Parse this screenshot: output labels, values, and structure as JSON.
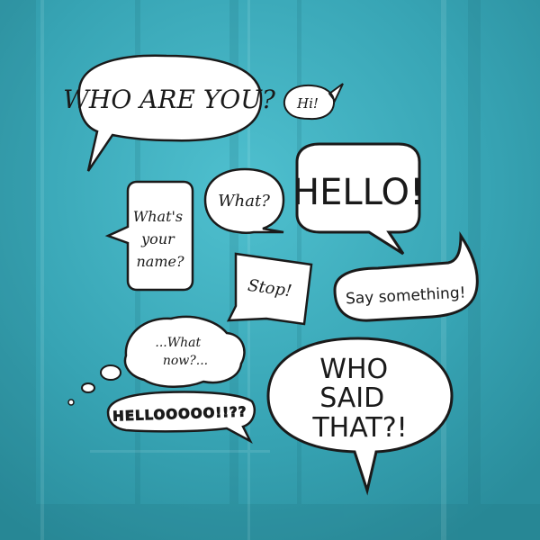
{
  "image": {
    "background_color": "#3aa5b5",
    "bubble_fill": "#ffffff",
    "ink_color": "#1a1a1a"
  },
  "bubbles": {
    "who_are_you": "WHO ARE YOU?",
    "hi": "Hi!",
    "hello": "HELLO!",
    "what": "What?",
    "whats_your_name_line1": "What's",
    "whats_your_name_line2": "your",
    "whats_your_name_line3": "name?",
    "stop": "Stop!",
    "say_something": "Say something!",
    "what_now_line1": "...What",
    "what_now_line2": "now?...",
    "helloooo": "HELLOOOOO!!??",
    "who_said_that_line1": "WHO",
    "who_said_that_line2": "SAID",
    "who_said_that_line3": "THAT?!"
  }
}
